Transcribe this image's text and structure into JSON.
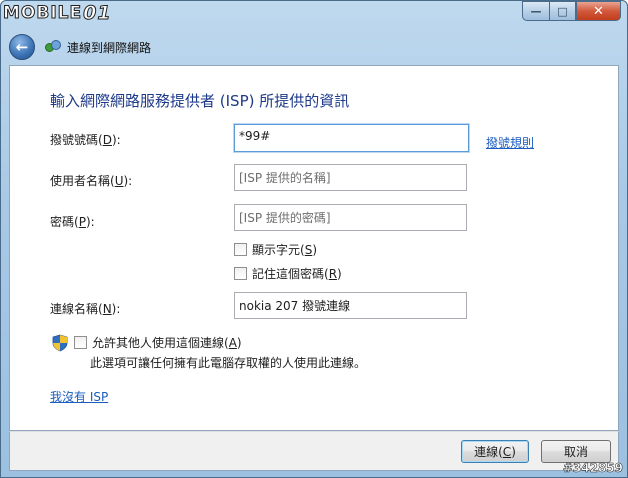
{
  "watermark": {
    "text": "MOBILE",
    "suffix": "01"
  },
  "nav": {
    "title": "連線到網際網路"
  },
  "heading": "輸入網際網路服務提供者 (ISP) 所提供的資訊",
  "fields": {
    "dial": {
      "label": "撥號號碼(",
      "key": "D",
      "label_end": "):",
      "value": "*99#",
      "link": "撥號規則"
    },
    "user": {
      "label": "使用者名稱(",
      "key": "U",
      "label_end": "):",
      "placeholder": "[ISP 提供的名稱]"
    },
    "pass": {
      "label": "密碼(",
      "key": "P",
      "label_end": "):",
      "placeholder": "[ISP 提供的密碼]"
    },
    "conn": {
      "label": "連線名稱(",
      "key": "N",
      "label_end": "):",
      "value": "nokia 207 撥號連線"
    }
  },
  "checks": {
    "show_chars": {
      "label": "顯示字元(",
      "key": "S",
      "label_end": ")"
    },
    "remember": {
      "label": "記住這個密碼(",
      "key": "R",
      "label_end": ")"
    },
    "allow": {
      "label": "允許其他人使用這個連線(",
      "key": "A",
      "label_end": ")"
    }
  },
  "note": "此選項可讓任何擁有此電腦存取權的人使用此連線。",
  "no_isp_link": "我沒有 ISP",
  "buttons": {
    "connect": {
      "label": "連線(",
      "key": "C",
      "label_end": ")"
    },
    "cancel": "取消"
  },
  "stamp": "#342859"
}
